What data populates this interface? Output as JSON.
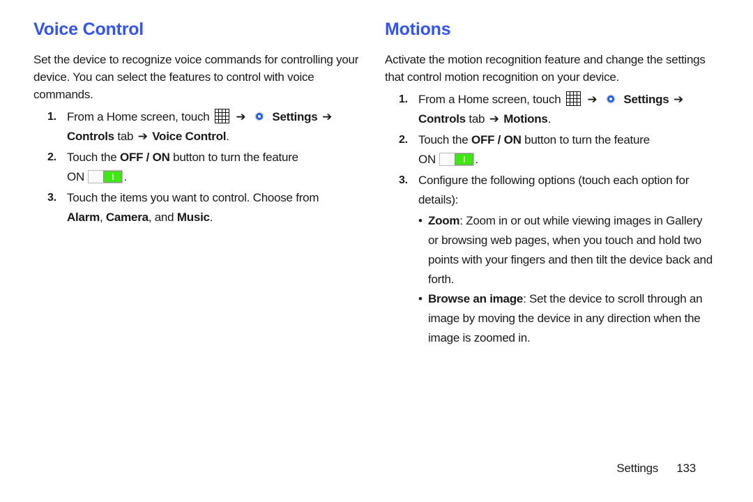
{
  "icons": {
    "apps": "apps-grid-icon",
    "settings_gear": "gear-icon",
    "toggle": "toggle-switch-on"
  },
  "colors": {
    "heading": "#3355ee",
    "body_text": "#1a1a1a",
    "toggle_on": "#3ee815",
    "gear_accent": "#1a5ceb"
  },
  "arrow_glyph": "➔",
  "bullet_glyph": "•",
  "left_column": {
    "title": "Voice Control",
    "intro": "Set the device to recognize voice commands for controlling your device. You can select the features to control with voice commands.",
    "steps": [
      {
        "num": "1.",
        "part_a": "From a Home screen, touch",
        "part_b": "Settings",
        "part_c": "Controls",
        "part_d": "tab",
        "part_e": "Voice Control",
        "part_f": "."
      },
      {
        "num": "2.",
        "part_a": "Touch the",
        "part_b": "OFF / ON",
        "part_c": "button to turn the feature",
        "part_d": "ON",
        "part_e": "."
      },
      {
        "num": "3.",
        "part_a": "Touch the items you want to control. Choose from",
        "part_b": "Alarm",
        "part_c": ",",
        "part_d": "Camera",
        "part_e": ", and",
        "part_f": "Music",
        "part_g": "."
      }
    ]
  },
  "right_column": {
    "title": "Motions",
    "intro": "Activate the motion recognition feature and change the settings that control motion recognition on your device.",
    "steps": [
      {
        "num": "1.",
        "part_a": "From a Home screen, touch",
        "part_b": "Settings",
        "part_c": "Controls",
        "part_d": "tab",
        "part_e": "Motions",
        "part_f": "."
      },
      {
        "num": "2.",
        "part_a": "Touch the",
        "part_b": "OFF / ON",
        "part_c": "button to turn the feature",
        "part_d": "ON",
        "part_e": "."
      },
      {
        "num": "3.",
        "part_a": "Configure the following options (touch each option for details):"
      }
    ],
    "bullets": [
      {
        "term": "Zoom",
        "body": ": Zoom in or out while viewing images in Gallery or browsing web pages, when you touch and hold two points with your fingers and then tilt the device back and forth."
      },
      {
        "term": "Browse an image",
        "body": ": Set the device to scroll through an image by moving the device in any direction when the image is zoomed in."
      }
    ]
  },
  "footer": {
    "label": "Settings",
    "page_number": "133"
  }
}
